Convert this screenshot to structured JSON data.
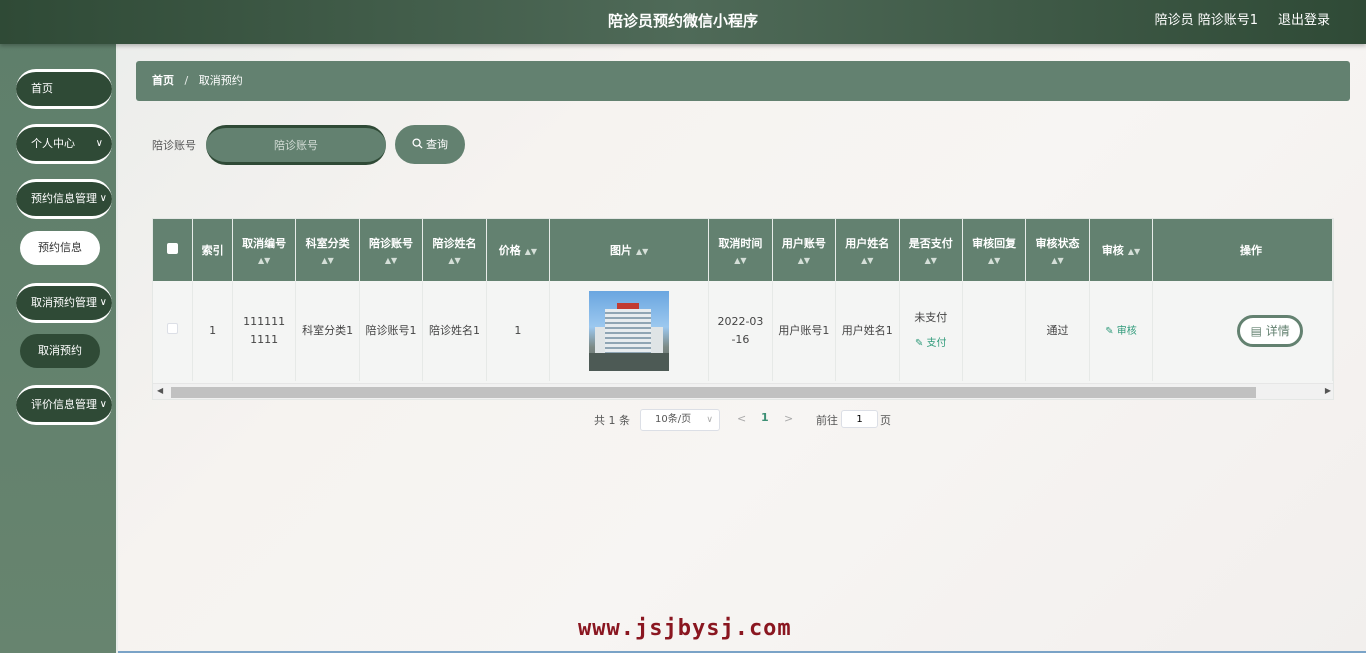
{
  "header": {
    "title": "陪诊员预约微信小程序",
    "user": "陪诊员 陪诊账号1",
    "logout": "退出登录"
  },
  "sidebar": {
    "items": [
      {
        "label": "首页"
      },
      {
        "label": "个人中心",
        "chevron": "∨"
      },
      {
        "label": "预约信息管理",
        "chevron": "∨"
      },
      {
        "label": "预约信息"
      },
      {
        "label": "取消预约管理",
        "chevron": "∨"
      },
      {
        "label": "取消预约"
      },
      {
        "label": "评价信息管理",
        "chevron": "∨"
      }
    ]
  },
  "breadcrumb": {
    "home": "首页",
    "separator": "/",
    "current": "取消预约"
  },
  "search": {
    "label": "陪诊账号",
    "placeholder": "陪诊账号",
    "button": "查询",
    "button_icon": "search-icon"
  },
  "table": {
    "columns": [
      "索引",
      "取消编号",
      "科室分类",
      "陪诊账号",
      "陪诊姓名",
      "价格",
      "图片",
      "取消时间",
      "用户账号",
      "用户姓名",
      "是否支付",
      "审核回复",
      "审核状态",
      "审核",
      "操作"
    ],
    "rows": [
      {
        "index": "1",
        "cancel_no": "1111111111",
        "department": "科室分类1",
        "escort_account": "陪诊账号1",
        "escort_name": "陪诊姓名1",
        "price": "1",
        "cancel_time": "2022-03-16",
        "user_account": "用户账号1",
        "user_name": "用户姓名1",
        "paid": "未支付",
        "pay_link": "支付",
        "review_reply": "",
        "review_status": "通过",
        "review_link": "审核",
        "detail_button": "详情"
      }
    ]
  },
  "pagination": {
    "total": "共 1 条",
    "page_size": "10条/页",
    "current_page": "1",
    "goto_label": "前往",
    "goto_value": "1",
    "page_unit": "页"
  },
  "watermark": "www.jsjbysj.com",
  "colors": {
    "primary": "#638170",
    "dark": "#2f4a36",
    "link": "#2f9a7a",
    "watermark": "#8a1620"
  }
}
